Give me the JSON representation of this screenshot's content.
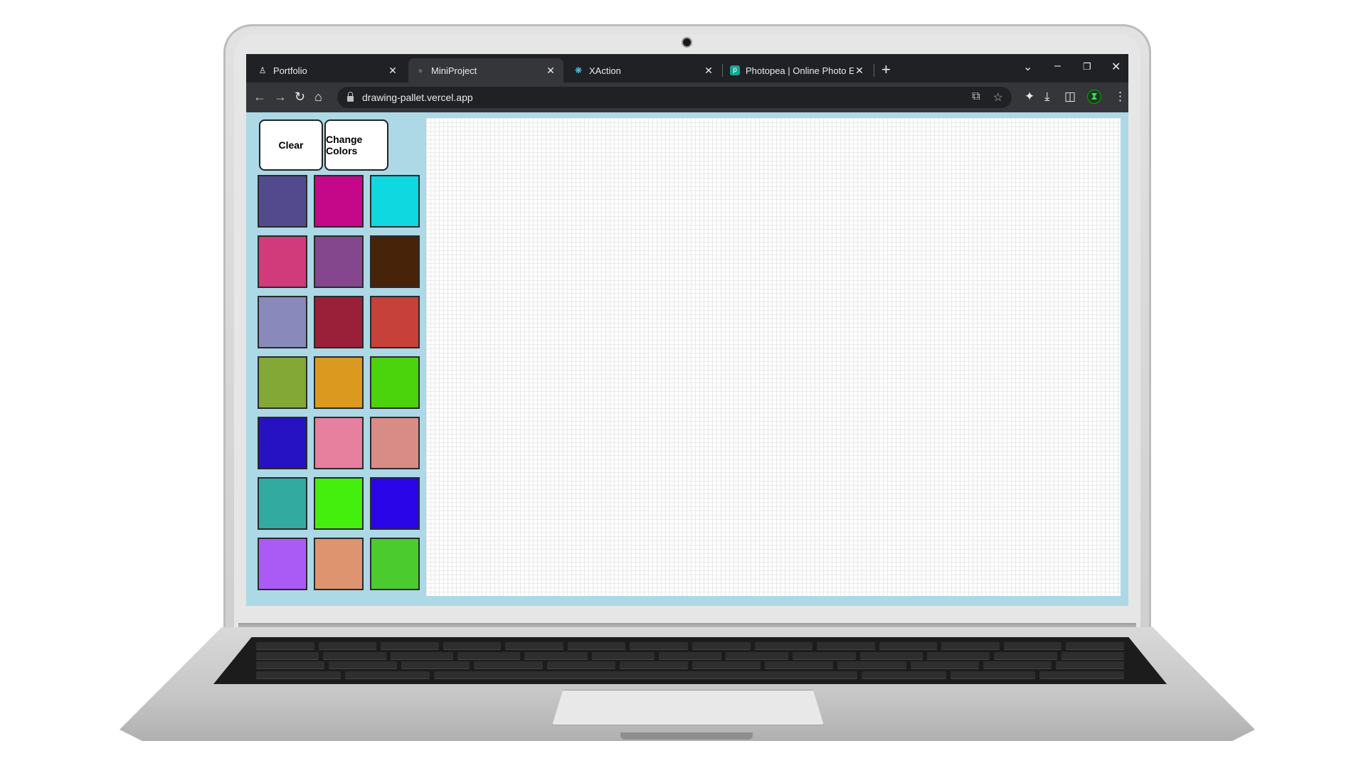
{
  "browser": {
    "tabs": [
      {
        "title": "Portfolio",
        "icon": "user-icon"
      },
      {
        "title": "MiniProject",
        "icon": "globe-icon"
      },
      {
        "title": "XAction",
        "icon": "react-icon"
      },
      {
        "title": "Photopea | Online Photo Editor",
        "icon": "photopea-icon"
      }
    ],
    "active_tab_index": 1,
    "url": "drawing-pallet.vercel.app"
  },
  "app": {
    "clear_label": "Clear",
    "change_colors_label": "Change Colors",
    "palette": [
      "#524a8c",
      "#c5078a",
      "#10d8e0",
      "#d13a7b",
      "#84468c",
      "#472309",
      "#8989bb",
      "#9a1f38",
      "#c6413a",
      "#83a836",
      "#db9a1f",
      "#4bd30b",
      "#2612c2",
      "#e77f9f",
      "#d88c85",
      "#33aa9f",
      "#44ef0e",
      "#2a05e8",
      "#ab5bf5",
      "#df9470",
      "#4bcb2e"
    ]
  }
}
